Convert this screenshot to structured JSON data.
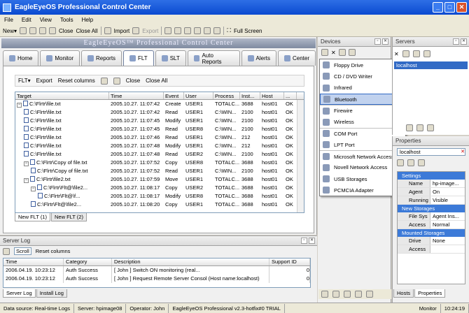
{
  "window": {
    "title": "EagleEyeOS Professional Control Center"
  },
  "menu": [
    "File",
    "Edit",
    "View",
    "Tools",
    "Help"
  ],
  "toolbar": {
    "new": "New",
    "close": "Close",
    "close_all": "Close All",
    "import": "Import",
    "export": "Export",
    "full_screen": "Full Screen"
  },
  "banner": "EagleEyeOS™ Professional Control Center",
  "nav_tabs": [
    "Home",
    "Monitor",
    "Reports",
    "FLT",
    "SLT",
    "Auto Reports",
    "Alerts",
    "Center"
  ],
  "flt_toolbar": {
    "flt": "FLT",
    "export": "Export",
    "reset_columns": "Reset columns",
    "close": "Close",
    "close_all": "Close All"
  },
  "grid": {
    "columns": [
      "Target",
      "Time",
      "Event",
      "User",
      "Process",
      "Inst...",
      "Host",
      "..."
    ],
    "rows": [
      {
        "indent": 0,
        "exp": "−",
        "target": "C:\\Flrtr\\file.txt",
        "time": "2005.10.27. 11:07:42",
        "event": "Create",
        "user": "USER1",
        "process": "TOTALC...",
        "inst": "3688",
        "host": "host01",
        "status": "OK"
      },
      {
        "indent": 1,
        "exp": "",
        "target": "C:\\Flrtr\\file.txt",
        "time": "2005.10.27. 11:07:42",
        "event": "Read",
        "user": "USER1",
        "process": "C:\\WIN...",
        "inst": "2100",
        "host": "host01",
        "status": "OK"
      },
      {
        "indent": 1,
        "exp": "",
        "target": "C:\\Flrtr\\file.txt",
        "time": "2005.10.27. 11:07:45",
        "event": "Modify",
        "user": "USER1",
        "process": "C:\\WIN...",
        "inst": "2100",
        "host": "host01",
        "status": "OK"
      },
      {
        "indent": 1,
        "exp": "",
        "target": "C:\\Flrtr\\file.txt",
        "time": "2005.10.27. 11:07:45",
        "event": "Read",
        "user": "USER8",
        "process": "C:\\WIN...",
        "inst": "2100",
        "host": "host01",
        "status": "OK"
      },
      {
        "indent": 1,
        "exp": "",
        "target": "C:\\Flrtr\\file.txt",
        "time": "2005.10.27. 11:07:46",
        "event": "Read",
        "user": "USER1",
        "process": "C:\\WIN...",
        "inst": "212",
        "host": "host01",
        "status": "OK"
      },
      {
        "indent": 1,
        "exp": "",
        "target": "C:\\Flrtr\\file.txt",
        "time": "2005.10.27. 11:07:48",
        "event": "Modify",
        "user": "USER1",
        "process": "C:\\WIN...",
        "inst": "212",
        "host": "host01",
        "status": "OK"
      },
      {
        "indent": 1,
        "exp": "",
        "target": "C:\\Flrtr\\file.txt",
        "time": "2005.10.27. 11:07:48",
        "event": "Read",
        "user": "USER2",
        "process": "C:\\WIN...",
        "inst": "2100",
        "host": "host01",
        "status": "OK"
      },
      {
        "indent": 1,
        "exp": "−",
        "target": "C:\\Flrtr\\Copy of file.txt",
        "time": "2005.10.27. 11:07:52",
        "event": "Copy",
        "user": "USER8",
        "process": "TOTALC...",
        "inst": "3688",
        "host": "host01",
        "status": "OK"
      },
      {
        "indent": 2,
        "exp": "",
        "target": "C:\\Flrtr\\Copy of file.txt",
        "time": "2005.10.27. 11:07:52",
        "event": "Read",
        "user": "USER1",
        "process": "C:\\WIN...",
        "inst": "2100",
        "host": "host01",
        "status": "OK"
      },
      {
        "indent": 1,
        "exp": "−",
        "target": "C:\\Flrtr\\file2.txt",
        "time": "2005.10.27. 11:07:59",
        "event": "Move",
        "user": "USER1",
        "process": "TOTALC...",
        "inst": "3688",
        "host": "host01",
        "status": "OK"
      },
      {
        "indent": 2,
        "exp": "−",
        "target": "C:\\Flrtr\\Flt@\\file2...",
        "time": "2005.10.27. 11:08:17",
        "event": "Copy",
        "user": "USER2",
        "process": "TOTALC...",
        "inst": "3688",
        "host": "host01",
        "status": "OK"
      },
      {
        "indent": 3,
        "exp": "",
        "target": "C:\\Flrtr\\Flt@\\f...",
        "time": "2005.10.27. 11:08:17",
        "event": "Modify",
        "user": "USER8",
        "process": "TOTALC...",
        "inst": "3688",
        "host": "host01",
        "status": "OK"
      },
      {
        "indent": 2,
        "exp": "",
        "target": "C:\\Flrtr\\Flt@\\file2...",
        "time": "2005.10.27. 11:08:20",
        "event": "Copy",
        "user": "USER1",
        "process": "TOTALC...",
        "inst": "3688",
        "host": "host01",
        "status": "OK"
      }
    ]
  },
  "grid_tabs": [
    "New FLT (1)",
    "New FLT (2)"
  ],
  "devices": {
    "title": "Devices",
    "menu": [
      "Floppy Drive",
      "CD / DVD Writer",
      "Infrared",
      "Bluetooth",
      "Firewire",
      "Wireless",
      "COM Port",
      "LPT Port",
      "Microsoft Network Access",
      "Novell Network Access",
      "USB Storages",
      "PCMCIA Adapter"
    ],
    "selected": "Bluetooth"
  },
  "servers": {
    "title": "Servers",
    "item": "localhost"
  },
  "properties": {
    "title": "Properties",
    "selected": "localhost",
    "categories": [
      {
        "name": "Settings",
        "rows": [
          {
            "k": "Name",
            "v": "hp-image..."
          },
          {
            "k": "Agent",
            "v": "On"
          },
          {
            "k": "Running",
            "v": "Visible"
          }
        ]
      },
      {
        "name": "New Storages",
        "rows": [
          {
            "k": "File Sys",
            "v": "Agent Ins..."
          },
          {
            "k": "Access",
            "v": "Normal"
          }
        ]
      },
      {
        "name": "Mounted Storages",
        "rows": [
          {
            "k": "Drive",
            "v": "None"
          },
          {
            "k": "Access",
            "v": ""
          }
        ]
      }
    ],
    "tabs": [
      "Hosts",
      "Properties"
    ]
  },
  "server_log": {
    "title": "Server Log",
    "toolbar": {
      "scroll": "Scroll",
      "reset_columns": "Reset columns"
    },
    "columns": [
      "Time",
      "Category",
      "Description",
      "Support ID"
    ],
    "rows": [
      {
        "time": "2006.04.19. 10:23:12",
        "category": "Auth Success",
        "description": "[ John ] Switch ON monitoring (real...",
        "support_id": "0"
      },
      {
        "time": "2006.04.19. 10:23:12",
        "category": "Auth Success",
        "description": "[ John ] Request Remote Server Consol (Host name:localhost)",
        "support_id": "0"
      }
    ],
    "tabs": [
      "Server Log",
      "Install Log"
    ]
  },
  "statusbar": {
    "data_source": "Data source: Real-time Logs",
    "server": "Server: hpimage08",
    "operator": "Operator: John",
    "version": "EagleEyeOS Professional v2.3-hotfix#0 TRIAL",
    "mode": "Monitor",
    "clock": "10:24:19"
  }
}
